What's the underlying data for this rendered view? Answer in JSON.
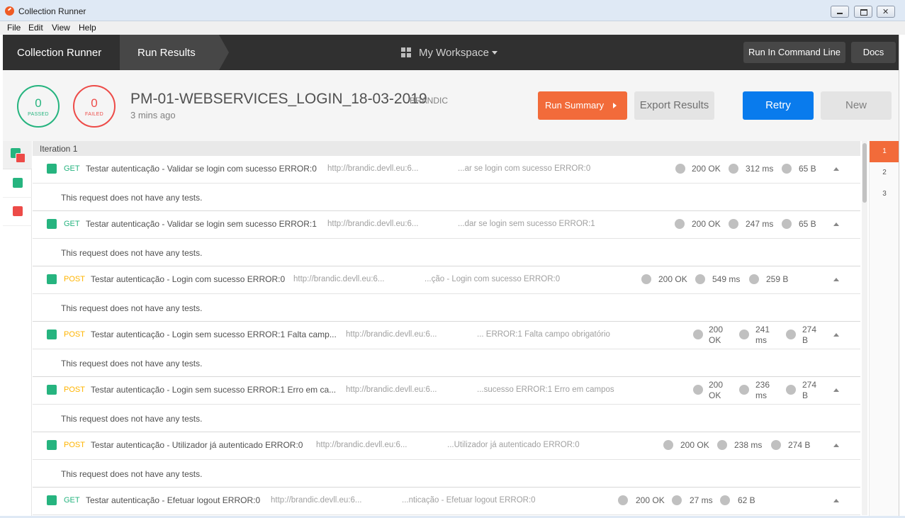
{
  "window": {
    "title": "Collection Runner"
  },
  "menu": [
    "File",
    "Edit",
    "View",
    "Help"
  ],
  "header": {
    "crumbs": [
      "Collection Runner",
      "Run Results"
    ],
    "workspace": "My Workspace",
    "cli_button": "Run In Command Line",
    "docs_button": "Docs"
  },
  "summary": {
    "passed_count": "0",
    "passed_label": "PASSED",
    "failed_count": "0",
    "failed_label": "FAILED",
    "run_name": "PM-01-WEBSERVICES_LOGIN_18-03-2019",
    "environment": "BRANDIC",
    "time_ago": "3 mins ago",
    "run_summary_button": "Run Summary",
    "export_button": "Export Results",
    "retry_button": "Retry",
    "new_button": "New"
  },
  "iteration_label": "Iteration 1",
  "no_tests_text": "This request does not have any tests.",
  "requests": [
    {
      "method": "GET",
      "name": "Testar autenticação - Validar se login com sucesso ERROR:0",
      "url": "http://brandic.devll.eu:6...",
      "tail": "...ar se login com sucesso ERROR:0",
      "status": "200 OK",
      "time": "312 ms",
      "size": "65 B"
    },
    {
      "method": "GET",
      "name": "Testar autenticação - Validar se login sem sucesso ERROR:1",
      "url": "http://brandic.devll.eu:6...",
      "tail": "...dar se login sem sucesso ERROR:1",
      "status": "200 OK",
      "time": "247 ms",
      "size": "65 B"
    },
    {
      "method": "POST",
      "name": "Testar autenticação - Login com sucesso ERROR:0",
      "url": "http://brandic.devll.eu:6...",
      "tail": "...ção - Login com sucesso ERROR:0",
      "status": "200 OK",
      "time": "549 ms",
      "size": "259 B"
    },
    {
      "method": "POST",
      "name": "Testar autenticação - Login sem sucesso ERROR:1 Falta camp...",
      "url": "http://brandic.devll.eu:6...",
      "tail": "... ERROR:1 Falta campo obrigatório",
      "status": "200 OK",
      "time": "241 ms",
      "size": "274 B"
    },
    {
      "method": "POST",
      "name": "Testar autenticação - Login sem sucesso ERROR:1 Erro em ca...",
      "url": "http://brandic.devll.eu:6...",
      "tail": "...sucesso ERROR:1 Erro em campos",
      "status": "200 OK",
      "time": "236 ms",
      "size": "274 B"
    },
    {
      "method": "POST",
      "name": "Testar autenticação - Utilizador já autenticado ERROR:0",
      "url": "http://brandic.devll.eu:6...",
      "tail": "...Utilizador já autenticado ERROR:0",
      "status": "200 OK",
      "time": "238 ms",
      "size": "274 B"
    },
    {
      "method": "GET",
      "name": "Testar autenticação - Efetuar logout ERROR:0",
      "url": "http://brandic.devll.eu:6...",
      "tail": "...nticação - Efetuar logout ERROR:0",
      "status": "200 OK",
      "time": "27 ms",
      "size": "62 B"
    }
  ],
  "iterations": [
    "1",
    "2",
    "3"
  ],
  "colors": {
    "pass": "#26b47f",
    "fail": "#ed4b48",
    "accent": "#f26b3a",
    "primary": "#097bed",
    "get": "#26b47f",
    "post": "#ffb400"
  }
}
